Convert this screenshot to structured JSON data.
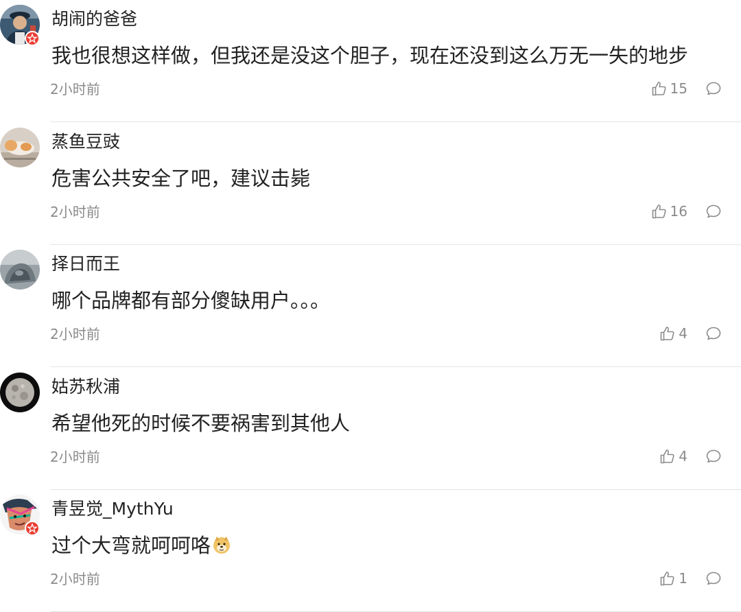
{
  "comments": [
    {
      "username": "胡闹的爸爸",
      "content": "我也很想这样做，但我还是没这个胆子，现在还没到这么万无一失的地步",
      "time": "2小时前",
      "likes": "15",
      "verified": true
    },
    {
      "username": "蒸鱼豆豉",
      "content": "危害公共安全了吧，建议击毙",
      "time": "2小时前",
      "likes": "16",
      "verified": false
    },
    {
      "username": "择日而王",
      "content": "哪个品牌都有部分傻缺用户。。。",
      "time": "2小时前",
      "likes": "4",
      "verified": false
    },
    {
      "username": "姑苏秋浦",
      "content": "希望他死的时候不要祸害到其他人",
      "time": "2小时前",
      "likes": "4",
      "verified": false
    },
    {
      "username": "青昱觉_MythYu",
      "content": "过个大弯就呵呵咯",
      "time": "2小时前",
      "likes": "1",
      "verified": true,
      "emoji": "doge-emoji"
    }
  ],
  "icons": {
    "like": "thumbs-up-icon",
    "reply": "comment-bubble-icon",
    "badge": "verified-star-badge-icon"
  },
  "colors": {
    "text": "#222222",
    "meta": "#8a8a8a",
    "divider": "#e5e5e5",
    "badge": "#ea3d33"
  }
}
